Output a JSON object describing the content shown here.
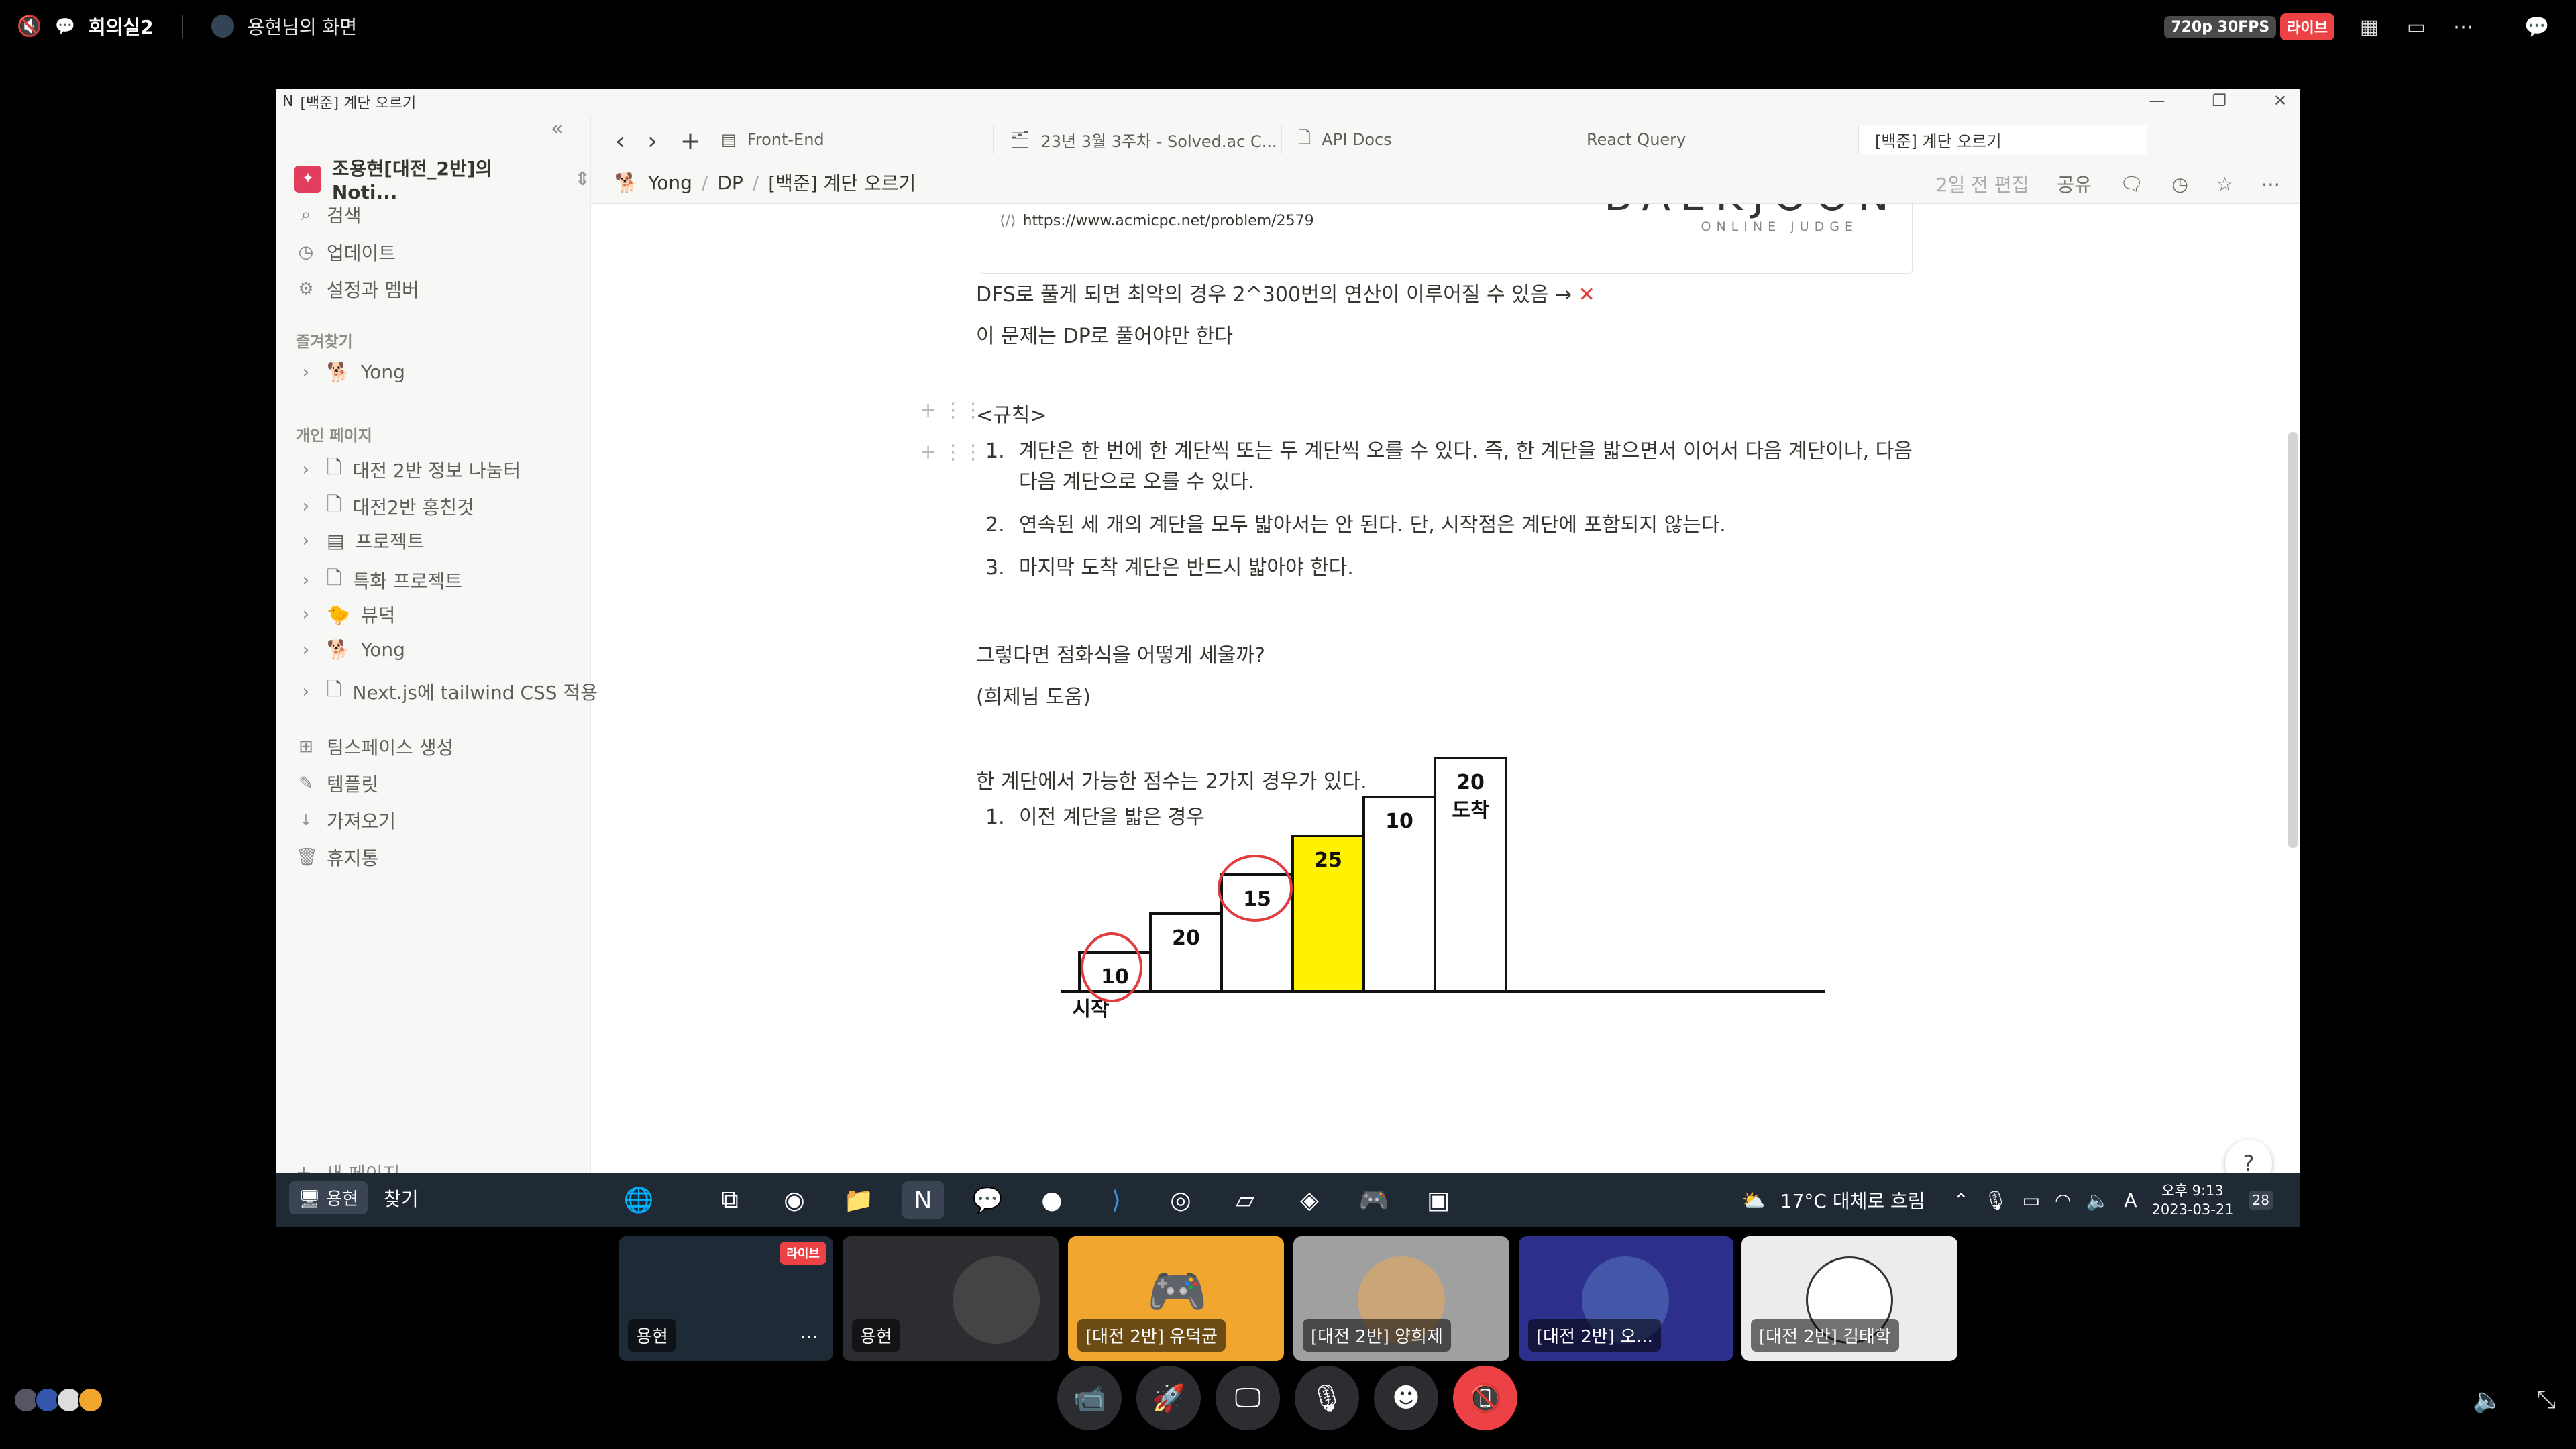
{
  "discord": {
    "room": "회의실2",
    "screen_owner": "용현님의 화면",
    "quality": "720p 30FPS",
    "live": "라이브"
  },
  "window": {
    "title": "[백준] 계단 오르기"
  },
  "sidebar": {
    "workspace": "조용현[대전_2반]의 Noti...",
    "menu": [
      {
        "icon": "search-icon",
        "label": "검색"
      },
      {
        "icon": "clock-icon",
        "label": "업데이트"
      },
      {
        "icon": "gear-icon",
        "label": "설정과 멤버"
      }
    ],
    "favorites_header": "즐겨찾기",
    "favorites": [
      "Yong"
    ],
    "personal_header": "개인 페이지",
    "pages": [
      "대전 2반 정보 나눔터",
      "대전2반 홍친것",
      "프로젝트",
      "특화 프로젝트",
      "뷰덕",
      "Yong",
      "Next.js에 tailwind CSS 적용"
    ],
    "bottom": [
      {
        "icon": "teamspace-icon",
        "label": "팀스페이스 생성"
      },
      {
        "icon": "template-icon",
        "label": "템플릿"
      },
      {
        "icon": "import-icon",
        "label": "가져오기"
      },
      {
        "icon": "trash-icon",
        "label": "휴지통"
      }
    ],
    "new_page": "새 페이지"
  },
  "tabs": [
    "Front-End",
    "23년 3월 3주차 - Solved.ac C...",
    "API Docs",
    "React Query",
    "[백준] 계단 오르기"
  ],
  "breadcrumb": [
    "Yong",
    "DP",
    "[백준] 계단 오르기"
  ],
  "topbar": {
    "edited": "2일 전 편집",
    "share": "공유"
  },
  "doc": {
    "bookmark_url": "https://www.acmicpc.net/problem/2579",
    "bookmark_logo": "BAEKJOON",
    "bookmark_logo_sub": "ONLINE JUDGE",
    "p1": "DFS로 풀게 되면 최악의 경우 2^300번의 연산이 이루어질 수 있음 → ",
    "p1_mark": "✕",
    "p2": "이 문제는 DP로 풀어야만 한다",
    "rules_title": "<규칙>",
    "rules": [
      "계단은 한 번에 한 계단씩 또는 두 계단씩 오를 수 있다. 즉, 한 계단을 밟으면서 이어서 다음 계단이나, 다음 다음 계단으로 오를 수 있다.",
      "연속된 세 개의 계단을 모두 밟아서는 안 된다. 단, 시작점은 계단에 포함되지 않는다.",
      "마지막 도착 계단은 반드시 밟아야 한다."
    ],
    "q1": "그렇다면 점화식을 어떻게 세울까?",
    "q2": "(희제님 도움)",
    "p3": "한 계단에서 가능한 점수는 2가지 경우가 있다.",
    "cases": [
      "이전 계단을 밟은 경우"
    ],
    "stairs": [
      "10",
      "20",
      "15",
      "25",
      "10",
      "20"
    ],
    "start_label": "시작",
    "end_label": "도착"
  },
  "taskbar": {
    "user": "용현",
    "search": "찾기",
    "weather": "17°C  대체로 흐림",
    "time": "오후 9:13",
    "date": "2023-03-21",
    "badge": "28"
  },
  "participants": [
    "용현",
    "용현",
    "[대전 2반] 유덕균",
    "[대전 2반] 양희제",
    "[대전 2반] 오...",
    "[대전 2반] 김태학"
  ]
}
